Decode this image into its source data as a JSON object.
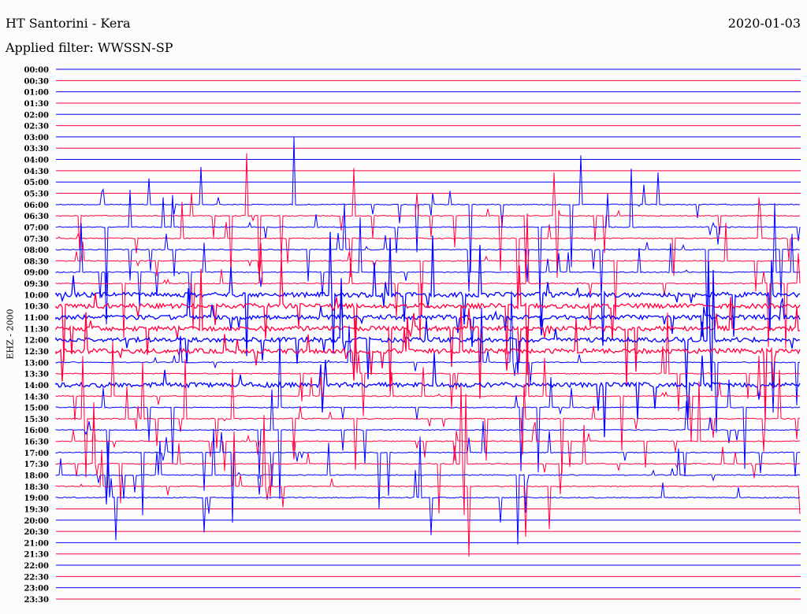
{
  "header": {
    "title": "HT Santorini - Kera",
    "date": "2020-01-03",
    "filter": "Applied filter: WWSSN-SP"
  },
  "chart_data": {
    "type": "line",
    "title": "HT Santorini - Kera",
    "subtitle": "Applied filter: WWSSN-SP",
    "ylabel": "EHZ - 2000",
    "xlabel": "",
    "row_labels": [
      "00:00",
      "00:30",
      "01:00",
      "01:30",
      "02:00",
      "02:30",
      "03:00",
      "03:30",
      "04:00",
      "04:30",
      "05:00",
      "05:30",
      "06:00",
      "06:30",
      "07:00",
      "07:30",
      "08:00",
      "08:30",
      "09:00",
      "09:30",
      "10:00",
      "10:30",
      "11:00",
      "11:30",
      "12:00",
      "12:30",
      "13:00",
      "13:30",
      "14:00",
      "14:30",
      "15:00",
      "15:30",
      "16:00",
      "16:30",
      "17:00",
      "17:30",
      "18:00",
      "18:30",
      "19:00",
      "19:30",
      "20:00",
      "20:30",
      "21:00",
      "21:30",
      "22:00",
      "22:30",
      "23:00",
      "23:30"
    ],
    "series_colors": [
      "#0000ff",
      "#ff0040"
    ],
    "active_rows": {
      "start": "06:00",
      "end": "19:00"
    },
    "noisy_rows": [
      "10:00",
      "10:30",
      "11:00",
      "11:30",
      "12:00",
      "12:30",
      "14:00"
    ]
  }
}
